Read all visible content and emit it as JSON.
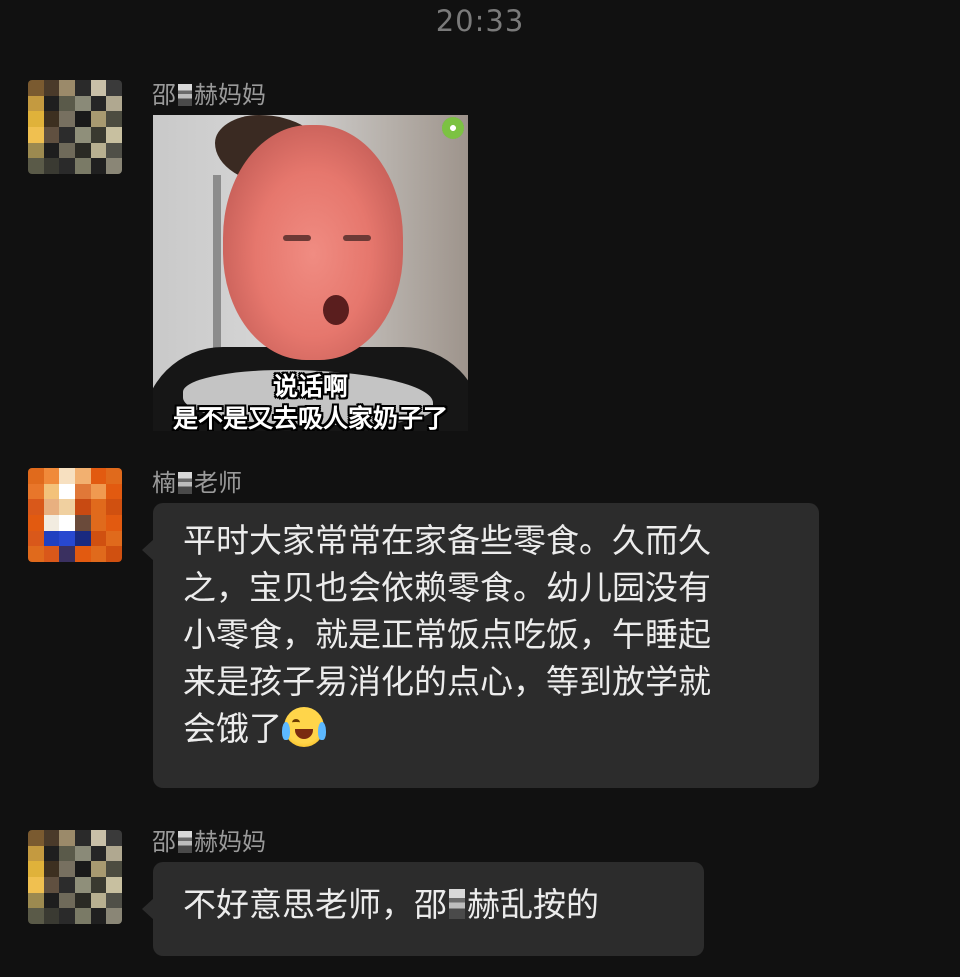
{
  "chat": {
    "timestamp": "20:33",
    "messages": [
      {
        "sender_prefix": "邵",
        "sender_suffix": "赫妈妈",
        "type": "image",
        "caption_line1": "说话啊",
        "caption_line2": "是不是又去吸人家奶子了"
      },
      {
        "sender_prefix": "楠",
        "sender_suffix": "老师",
        "type": "text",
        "lines": [
          "平时大家常常在家备些零食。久而久",
          "之，宝贝也会依赖零食。幼儿园没有",
          "小零食，就是正常饭点吃饭，午睡起",
          "来是孩子易消化的点心，等到放学就",
          "会饿了"
        ],
        "emoji": "loudly-crying-face"
      },
      {
        "sender_prefix": "邵",
        "sender_suffix": "赫妈妈",
        "type": "text",
        "text_prefix": "不好意思老师，邵",
        "text_suffix": "赫乱按的"
      }
    ]
  },
  "colors": {
    "background": "#111111",
    "bubble": "#2c2c2c",
    "sender_name": "#9a9a9a",
    "timestamp": "#7a7a7a"
  }
}
